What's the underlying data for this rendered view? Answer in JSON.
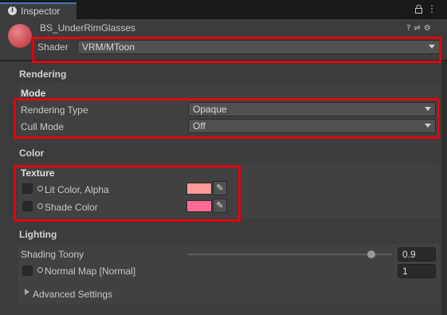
{
  "tab": {
    "title": "Inspector",
    "icon": "info-icon"
  },
  "toolbar": {
    "lock_icon": "lock-icon",
    "menu_icon": "kebab-menu-icon"
  },
  "header": {
    "object_name": "BS_UnderRimGlasses",
    "icons": [
      "help-icon",
      "presets-icon",
      "gear-icon"
    ],
    "shader_label": "Shader",
    "shader_value": "VRM/MToon"
  },
  "rendering": {
    "title": "Rendering",
    "mode_title": "Mode",
    "rendering_type_label": "Rendering Type",
    "rendering_type_value": "Opaque",
    "cull_mode_label": "Cull Mode",
    "cull_mode_value": "Off"
  },
  "color": {
    "title": "Color",
    "texture_title": "Texture",
    "lit_color_label": "Lit Color, Alpha",
    "lit_color_swatch": "#ff9a9a",
    "shade_color_label": "Shade Color",
    "shade_color_swatch": "#ff6a95"
  },
  "lighting": {
    "title": "Lighting",
    "shading_toony_label": "Shading Toony",
    "shading_toony_value": "0.9",
    "shading_toony_fraction": 0.9,
    "normal_map_label": "Normal Map [Normal]",
    "normal_map_value": "1",
    "advanced_label": "Advanced Settings"
  },
  "colors": {
    "highlight": "#e3000f",
    "tab_accent": "#3a79bb",
    "material": "#c9454f"
  }
}
